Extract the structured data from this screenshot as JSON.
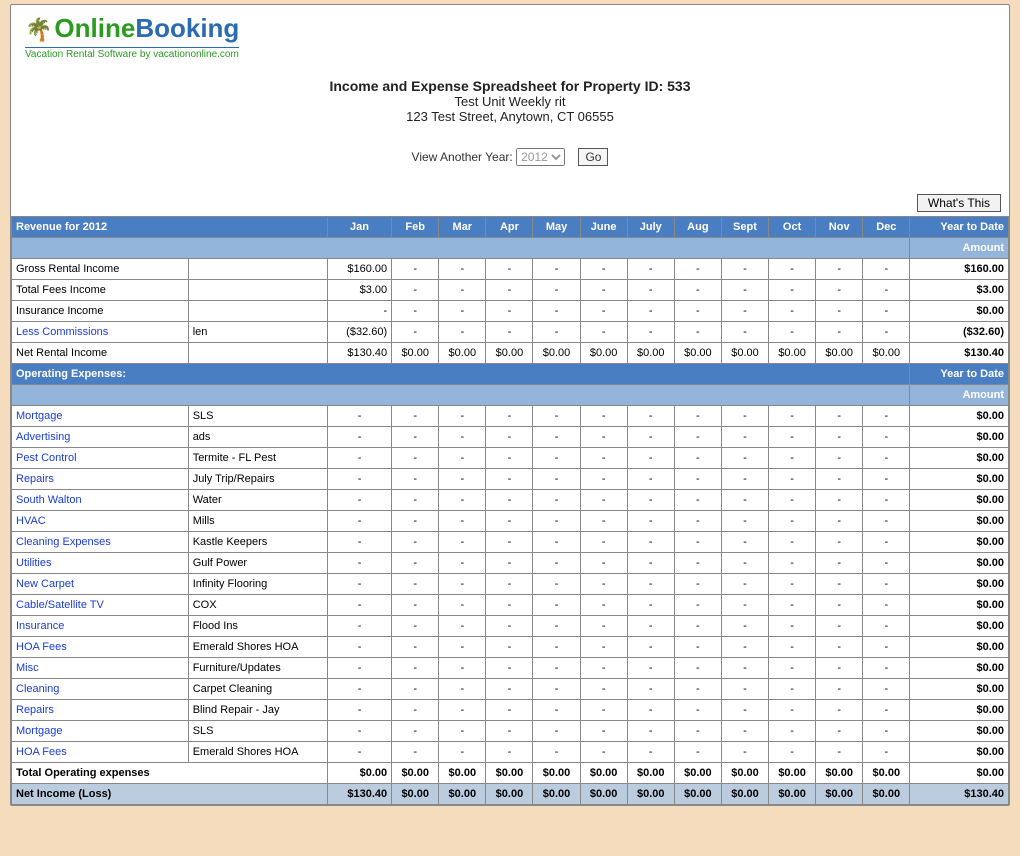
{
  "logo": {
    "brand1": "Online",
    "brand2": "Booking",
    "tagline": "Vacation Rental Software by vacationonline.com"
  },
  "header": {
    "title": "Income and Expense Spreadsheet for Property ID: 533",
    "line2": "Test Unit Weekly rit",
    "line3": "123 Test Street, Anytown, CT 06555"
  },
  "yearsel": {
    "label": "View Another Year:",
    "value": "2012",
    "go": "Go"
  },
  "whats": "What's This",
  "months": [
    "Jan",
    "Feb",
    "Mar",
    "Apr",
    "May",
    "June",
    "July",
    "Aug",
    "Sept",
    "Oct",
    "Nov",
    "Dec"
  ],
  "revenue_header": "Revenue for 2012",
  "ytd_label": "Year to Date",
  "amount_label": "Amount",
  "revenue_rows": [
    {
      "label": "Gross Rental Income",
      "vendor": "",
      "vals": [
        "$160.00",
        "-",
        "-",
        "-",
        "-",
        "-",
        "-",
        "-",
        "-",
        "-",
        "-",
        "-"
      ],
      "ytd": "$160.00",
      "link": false
    },
    {
      "label": "Total Fees Income",
      "vendor": "",
      "vals": [
        "$3.00",
        "-",
        "-",
        "-",
        "-",
        "-",
        "-",
        "-",
        "-",
        "-",
        "-",
        "-"
      ],
      "ytd": "$3.00",
      "link": false
    },
    {
      "label": "Insurance Income",
      "vendor": "",
      "vals": [
        "-",
        "-",
        "-",
        "-",
        "-",
        "-",
        "-",
        "-",
        "-",
        "-",
        "-",
        "-"
      ],
      "ytd": "$0.00",
      "link": false
    },
    {
      "label": "Less Commissions",
      "vendor": "len",
      "vals": [
        "($32.60)",
        "-",
        "-",
        "-",
        "-",
        "-",
        "-",
        "-",
        "-",
        "-",
        "-",
        "-"
      ],
      "ytd": "($32.60)",
      "link": true
    },
    {
      "label": "Net Rental Income",
      "vendor": "",
      "vals": [
        "$130.40",
        "$0.00",
        "$0.00",
        "$0.00",
        "$0.00",
        "$0.00",
        "$0.00",
        "$0.00",
        "$0.00",
        "$0.00",
        "$0.00",
        "$0.00"
      ],
      "ytd": "$130.40",
      "link": false
    }
  ],
  "expense_header": "Operating Expenses:",
  "expense_rows": [
    {
      "label": "Mortgage",
      "vendor": "SLS"
    },
    {
      "label": "Advertising",
      "vendor": "ads"
    },
    {
      "label": "Pest Control",
      "vendor": "Termite - FL Pest"
    },
    {
      "label": "Repairs",
      "vendor": "July Trip/Repairs"
    },
    {
      "label": "South Walton",
      "vendor": "Water"
    },
    {
      "label": "HVAC",
      "vendor": "Mills"
    },
    {
      "label": "Cleaning Expenses",
      "vendor": "Kastle Keepers"
    },
    {
      "label": "Utilities",
      "vendor": "Gulf Power"
    },
    {
      "label": "New Carpet",
      "vendor": "Infinity Flooring"
    },
    {
      "label": "Cable/Satellite TV",
      "vendor": "COX"
    },
    {
      "label": "Insurance",
      "vendor": "Flood Ins"
    },
    {
      "label": "HOA Fees",
      "vendor": "Emerald Shores HOA"
    },
    {
      "label": "Misc",
      "vendor": "Furniture/Updates"
    },
    {
      "label": "Cleaning",
      "vendor": "Carpet Cleaning"
    },
    {
      "label": "Repairs",
      "vendor": "Blind Repair - Jay"
    },
    {
      "label": "Mortgage",
      "vendor": "SLS"
    },
    {
      "label": "HOA Fees",
      "vendor": "Emerald Shores HOA"
    }
  ],
  "expense_dash_ytd": "$0.00",
  "total_exp": {
    "label": "Total Operating expenses",
    "vals": [
      "$0.00",
      "$0.00",
      "$0.00",
      "$0.00",
      "$0.00",
      "$0.00",
      "$0.00",
      "$0.00",
      "$0.00",
      "$0.00",
      "$0.00",
      "$0.00"
    ],
    "ytd": "$0.00"
  },
  "net": {
    "label": "Net Income (Loss)",
    "vals": [
      "$130.40",
      "$0.00",
      "$0.00",
      "$0.00",
      "$0.00",
      "$0.00",
      "$0.00",
      "$0.00",
      "$0.00",
      "$0.00",
      "$0.00",
      "$0.00"
    ],
    "ytd": "$130.40"
  }
}
